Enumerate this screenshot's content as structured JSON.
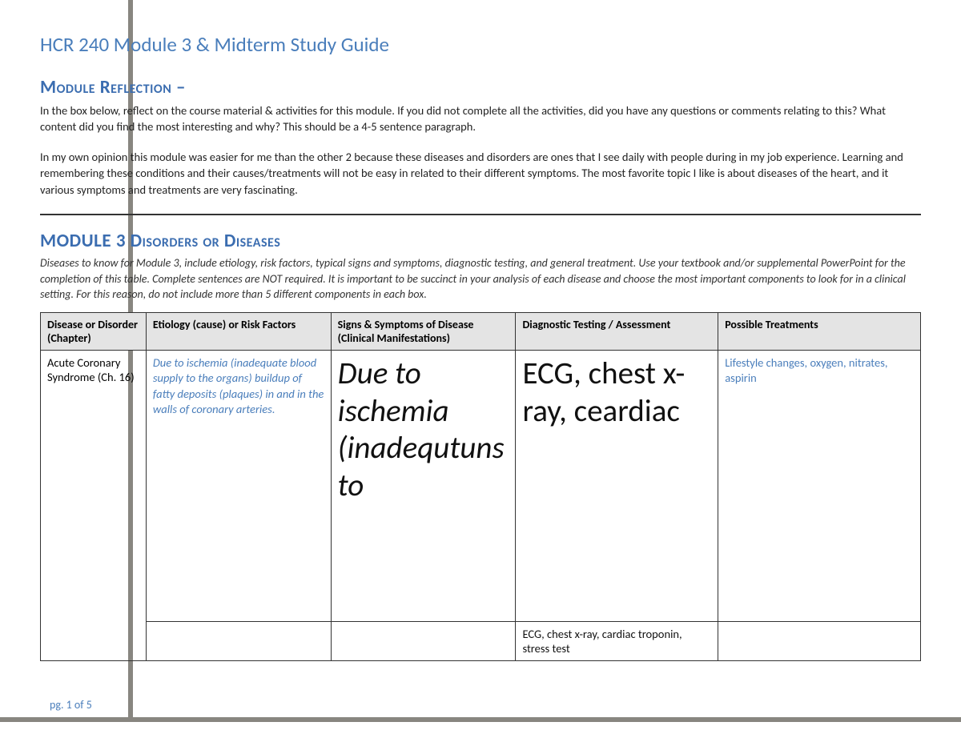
{
  "doc": {
    "title": "HCR 240 Module 3 & Midterm Study Guide",
    "footer": "pg. 1 of 5"
  },
  "section1": {
    "heading": "Module Reflection –",
    "instruction": "In the box below, reflect on the course material & activities for this module.  If you did not complete all the activities, did you have any questions or comments relating to this?  What content did you find the most interesting and why?  This should be a 4-5 sentence paragraph.",
    "body": "In my own opinion this module was easier for me than the other 2 because these diseases and disorders are ones that I see daily with people during in my job experience. Learning and remembering these conditions and their causes/treatments will not be easy in related to their different symptoms. The most favorite topic I like is about diseases of the heart, and it various symptoms and treatments are very fascinating."
  },
  "section2": {
    "heading": "MODULE 3 Disorders or Diseases",
    "instruction": "Diseases to know for Module 3, include etiology, risk factors, typical signs and symptoms, diagnostic testing, and general treatment.  Use your textbook and/or supplemental PowerPoint for the completion of this table.  Complete sentences are NOT required.  It is important to be succinct in your analysis of each disease and choose the most important components to look for in a clinical setting. For this reason, do not include more than 5 different components in each box."
  },
  "table": {
    "headers": {
      "c1": "Disease or Disorder (Chapter)",
      "c2": "Etiology (cause) or Risk Factors",
      "c3": "Signs & Symptoms of Disease (Clinical Manifestations)",
      "c4": "Diagnostic Testing / Assessment",
      "c5": "Possible Treatments"
    },
    "rows": [
      {
        "name": "Acute Coronary Syndrome (Ch. 16)",
        "etiology": "Due to ischemia (inadequate blood supply to the organs) buildup of fatty deposits (plaques) in and in the walls of coronary arteries.",
        "signs": "Due to ischemia (inadequtunsto",
        "diagnostic": "ECG, chest x-ray, ceardiac",
        "treatments": "Lifestyle changes, oxygen, nitrates, aspirin"
      },
      {
        "name": "",
        "etiology": "",
        "signs": "",
        "diagnostic": "ECG, chest x-ray, cardiac troponin, stress test",
        "treatments": ""
      }
    ]
  }
}
